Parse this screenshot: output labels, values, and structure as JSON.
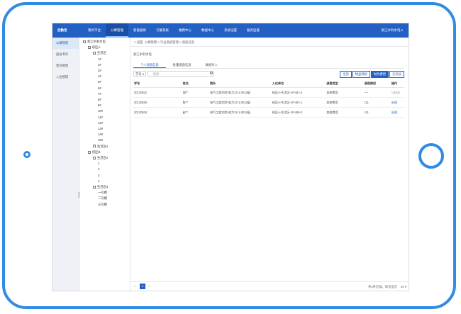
{
  "app": {
    "brand": "后勤宝",
    "nav": [
      "我的平台",
      "公寓管理",
      "智能报修",
      "订餐系统",
      "缴费中心",
      "数据中心",
      "系统设置",
      "服务监督"
    ],
    "active_nav": 1,
    "user": "浙江水利水电 ▾"
  },
  "sidebar": {
    "items": [
      "公寓管理",
      "宿舍考评",
      "登记管理",
      "入住管理"
    ],
    "active": 0
  },
  "tree": {
    "nodes": [
      {
        "label": "浙江水利水电",
        "level": 0,
        "box": true
      },
      {
        "label": "校区A",
        "level": 1,
        "box": true
      },
      {
        "label": "生活区",
        "level": 2,
        "box": true
      },
      {
        "label": "1#",
        "level": 3
      },
      {
        "label": "2#",
        "level": 3
      },
      {
        "label": "3#",
        "level": 3
      },
      {
        "label": "4#",
        "level": 3
      },
      {
        "label": "5#",
        "level": 3
      },
      {
        "label": "6#",
        "level": 3
      },
      {
        "label": "7#",
        "level": 3
      },
      {
        "label": "8#",
        "level": 3
      },
      {
        "label": "9#",
        "level": 3
      },
      {
        "label": "10#",
        "level": 3
      },
      {
        "label": "11#",
        "level": 3
      },
      {
        "label": "12#",
        "level": 3
      },
      {
        "label": "13#",
        "level": 3
      },
      {
        "label": "14#",
        "level": 3
      },
      {
        "label": "15#",
        "level": 3
      },
      {
        "label": "生活区2",
        "level": 2,
        "box": true
      },
      {
        "label": "校区B",
        "level": 1,
        "box": true
      },
      {
        "label": "生活区2",
        "level": 2,
        "box": true
      },
      {
        "label": "1",
        "level": 3
      },
      {
        "label": "2",
        "level": 3
      },
      {
        "label": "3",
        "level": 3
      },
      {
        "label": "4",
        "level": 3
      },
      {
        "label": "生活区3",
        "level": 2,
        "box": true
      },
      {
        "label": "一号楼",
        "level": 3
      },
      {
        "label": "二号楼",
        "level": 3
      },
      {
        "label": "三号楼",
        "level": 3
      }
    ]
  },
  "breadcrumb": {
    "back": "< 返回",
    "path": "公寓管理 > 毕业退宿管理 > 退宿信息"
  },
  "org_title": "浙江水利水电",
  "tabs": [
    "个人退宿信息",
    "批量退宿信息",
    "数据导入"
  ],
  "active_tab": 0,
  "filter": {
    "select": "学号 ▾",
    "search_placeholder": "检索",
    "chips": [
      "全部",
      "物品缺损",
      "财务费用",
      "无异议"
    ],
    "active_chip": 2
  },
  "table": {
    "headers": [
      "学号",
      "姓名",
      "院系",
      "入住单位",
      "退宿类型",
      "退宿费用",
      "操作"
    ],
    "rows": [
      [
        "20120631",
        "周**",
        "电气工程学院-电力12-1-2012级",
        "校区A-生活区-1#-401-4",
        "其他费用",
        "----",
        "已核准"
      ],
      [
        "20120625",
        "陈**",
        "电气工程学院-电力12-1-2012级",
        "校区A-生活区-1#-401-1",
        "其他费用",
        "111",
        "处理"
      ],
      [
        "20120624",
        "赵**",
        "电气工程学院-电力12-1-2012级",
        "校区A-生活区-1#-406-2",
        "其他费用",
        "111",
        "处理"
      ]
    ],
    "op_muted": [
      true,
      false,
      false
    ]
  },
  "pager": {
    "prev": "«",
    "page": "1",
    "next": "»",
    "summary": "共3条记录，每页显示",
    "size": "10 ▾"
  },
  "colors": {
    "accent": "#2360c4",
    "frame": "#2f8be6"
  }
}
